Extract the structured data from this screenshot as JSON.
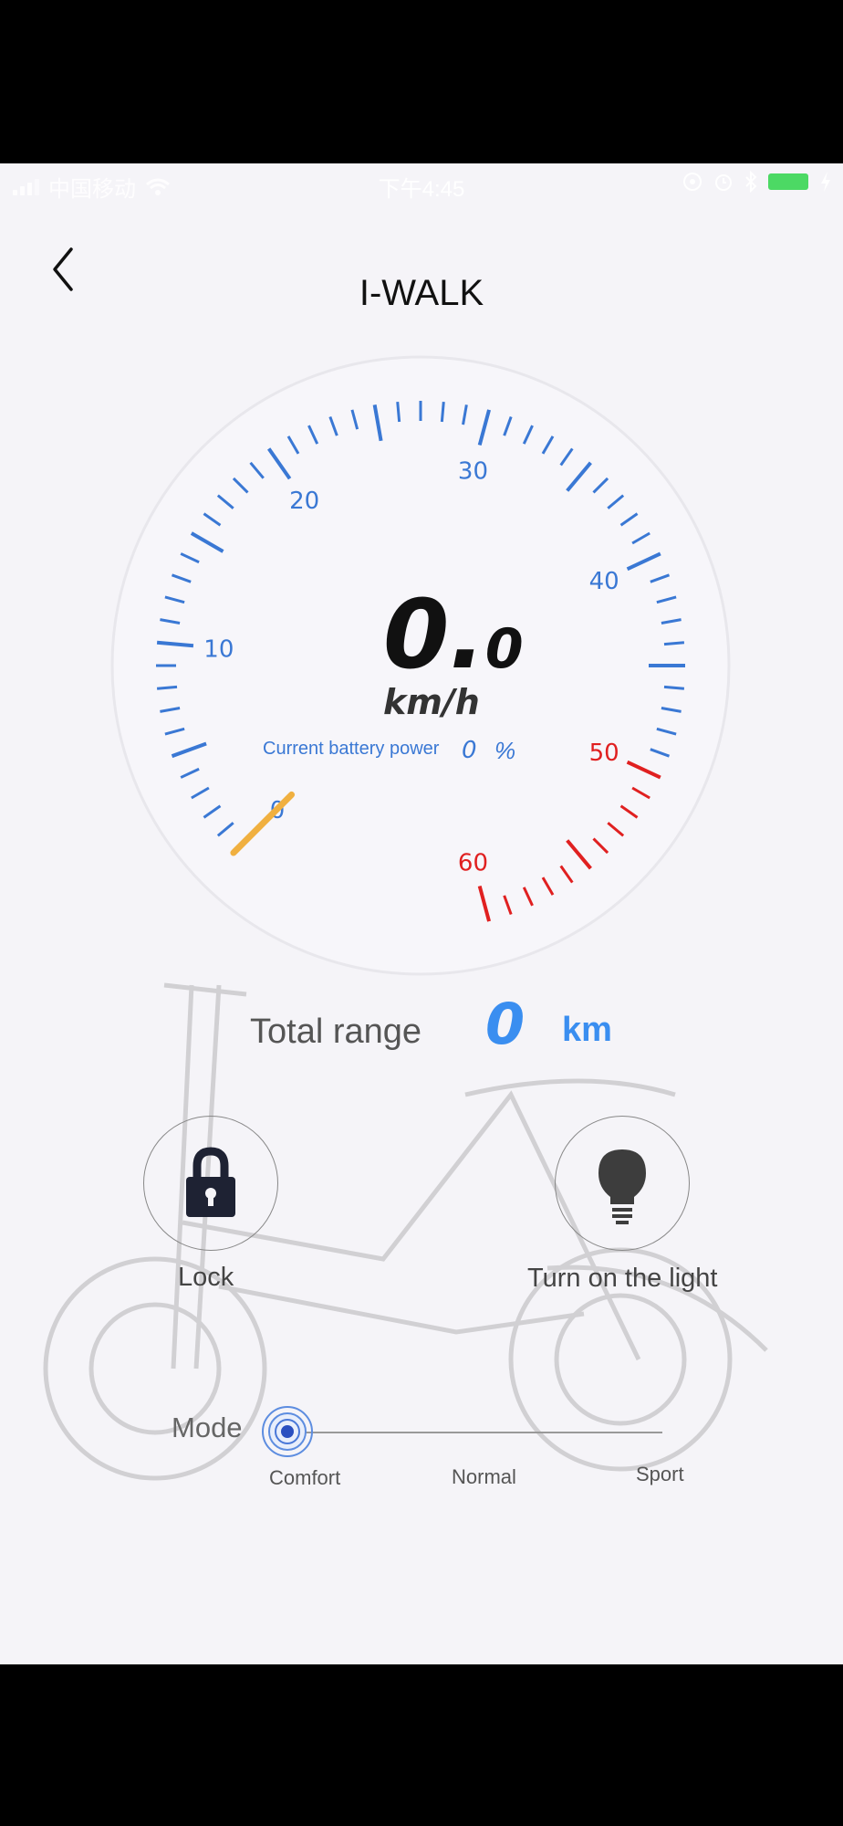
{
  "status_bar": {
    "carrier": "中国移动",
    "time": "下午4:45"
  },
  "header": {
    "title": "I-WALK"
  },
  "gauge": {
    "speed_int": "0.",
    "speed_dec": "0",
    "unit": "km/h",
    "tick_labels": [
      "0",
      "10",
      "20",
      "30",
      "40",
      "50",
      "60"
    ],
    "battery_label": "Current battery power",
    "battery_value": "0",
    "battery_unit": "%"
  },
  "range": {
    "label": "Total range",
    "value": "0",
    "unit": "km"
  },
  "controls": {
    "lock_label": "Lock",
    "light_label": "Turn on the light"
  },
  "mode": {
    "label": "Mode",
    "options": [
      "Comfort",
      "Normal",
      "Sport"
    ],
    "selected": "Comfort"
  },
  "colors": {
    "accent": "#3a78d4",
    "danger": "#e02020",
    "needle": "#f0b040",
    "range": "#3a8ef0"
  }
}
